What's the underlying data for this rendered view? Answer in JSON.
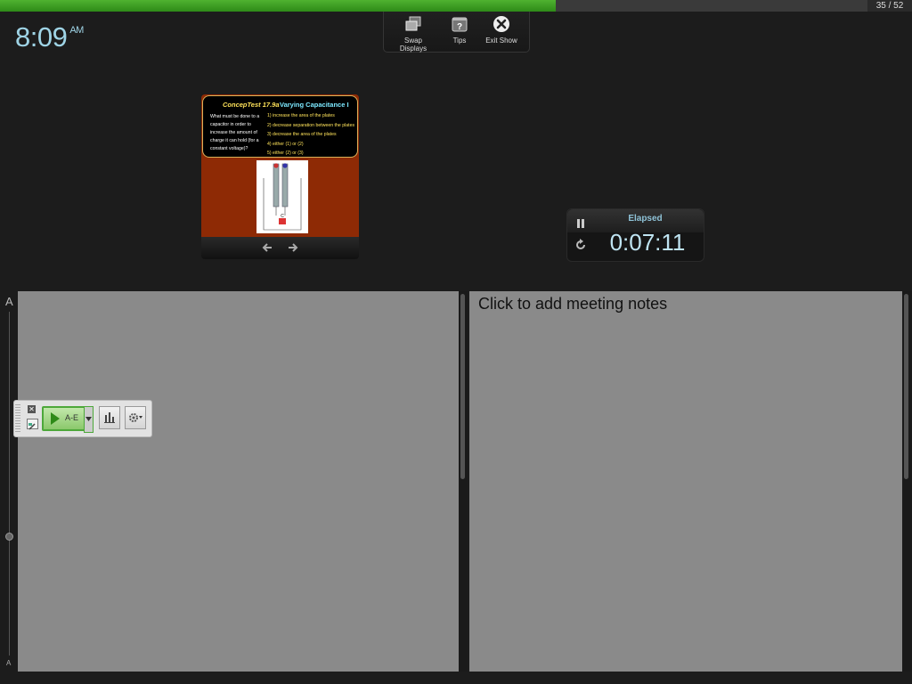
{
  "progress": {
    "fraction": 0.641,
    "counter": "35 / 52"
  },
  "clock": {
    "time": "8:09",
    "ampm": "AM"
  },
  "toolbar": {
    "swap_label": "Swap Displays",
    "tips_label": "Tips",
    "exit_label": "Exit Show"
  },
  "slide": {
    "title_a": "ConcepTest 17.9a",
    "title_b": "Varying Capacitance I",
    "question": "What must be done to a capacitor in order to increase the amount of charge it can hold (for a constant voltage)?",
    "options": [
      "1)  increase the area of the plates",
      "2)  decrease separation between the plates",
      "3)  decrease the area of the plates",
      "4)  either (1) or (2)",
      "5)  either (2) or (3)"
    ]
  },
  "timer": {
    "label": "Elapsed",
    "value": "0:07:11"
  },
  "notes": {
    "placeholder": "Click to add meeting notes"
  },
  "font_slider": {
    "large": "A",
    "small": "A"
  },
  "poll": {
    "start_label": "A-E"
  },
  "colors": {
    "progress_green": "#3e9e24",
    "clock_text": "#9fd4e6",
    "pane_gray": "#8a8a8a"
  }
}
